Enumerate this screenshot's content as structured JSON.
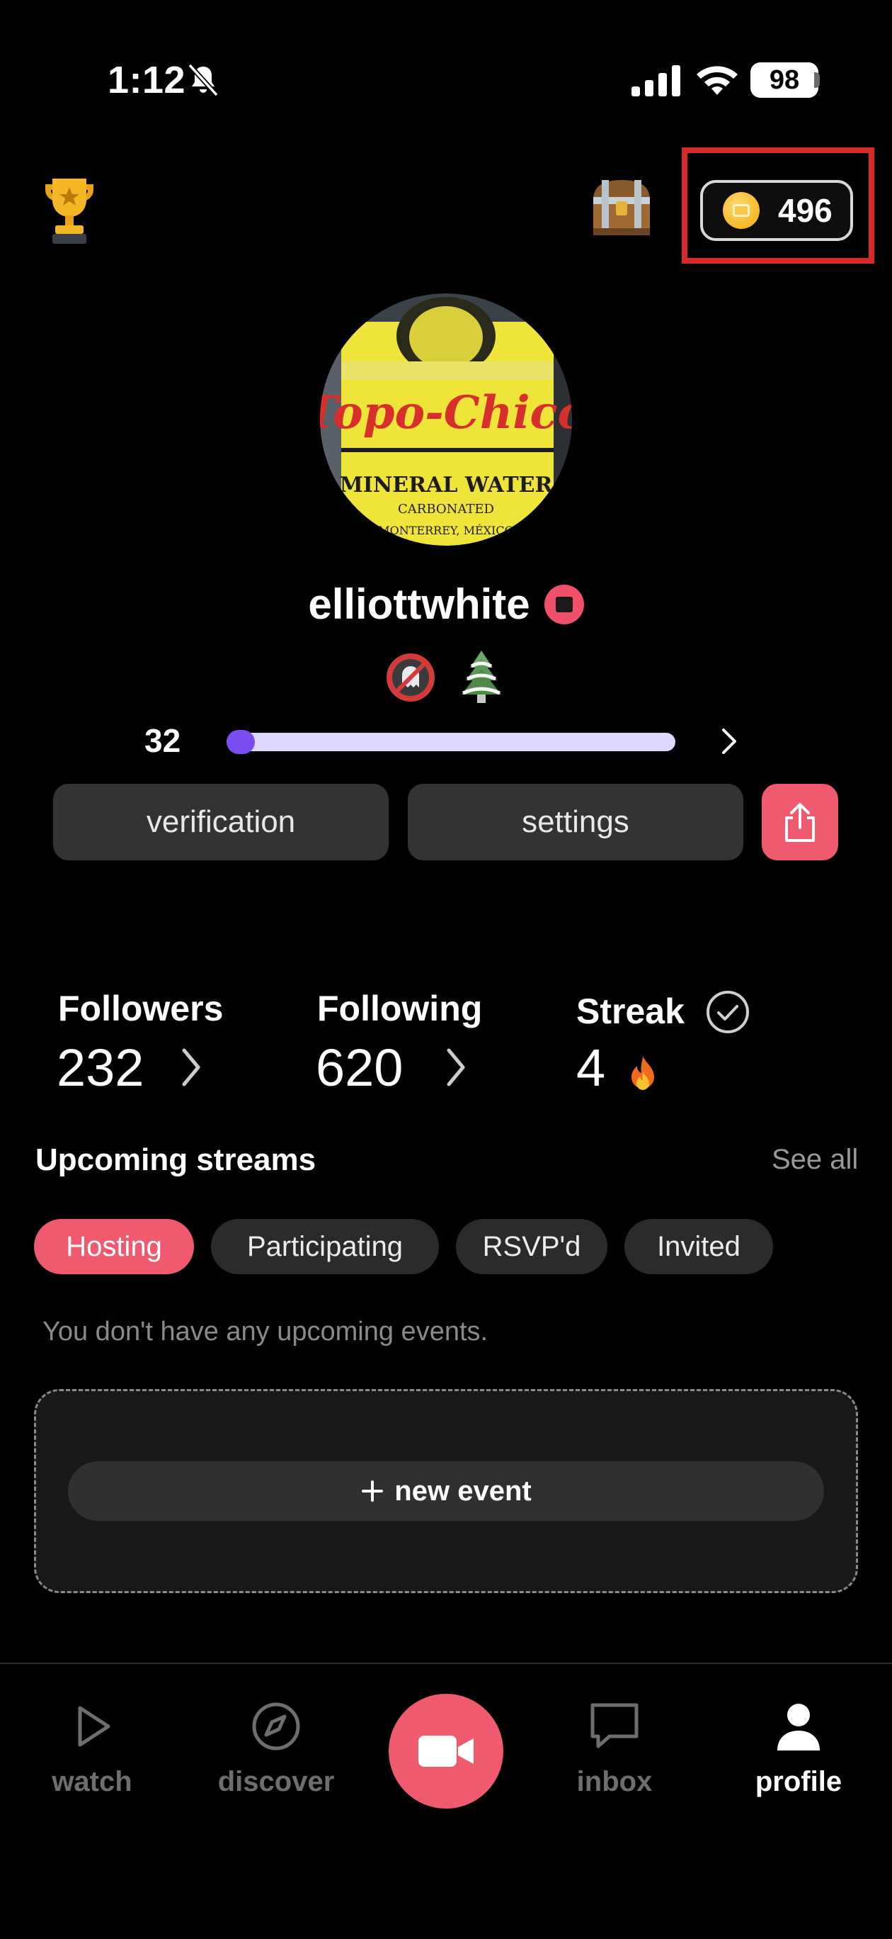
{
  "status_bar": {
    "time": "1:12",
    "battery": "98"
  },
  "header": {
    "coin_count": "496"
  },
  "profile": {
    "username": "elliottwhite",
    "level": "32",
    "level_progress": 0.03,
    "verification_label": "verification",
    "settings_label": "settings"
  },
  "stats": {
    "followers_label": "Followers",
    "followers_value": "232",
    "following_label": "Following",
    "following_value": "620",
    "streak_label": "Streak",
    "streak_value": "4"
  },
  "upcoming": {
    "title": "Upcoming streams",
    "see_all": "See all",
    "tabs": [
      "Hosting",
      "Participating",
      "RSVP'd",
      "Invited"
    ],
    "active_tab": "Hosting",
    "empty_note": "You don't have any upcoming events.",
    "new_event_label": "new event"
  },
  "tab_bar": {
    "items": [
      "watch",
      "discover",
      "inbox",
      "profile"
    ],
    "active": "profile"
  },
  "colors": {
    "accent": "#f05a6e",
    "level_fill": "#7b4cf0",
    "highlight_box": "#d62a2a"
  }
}
